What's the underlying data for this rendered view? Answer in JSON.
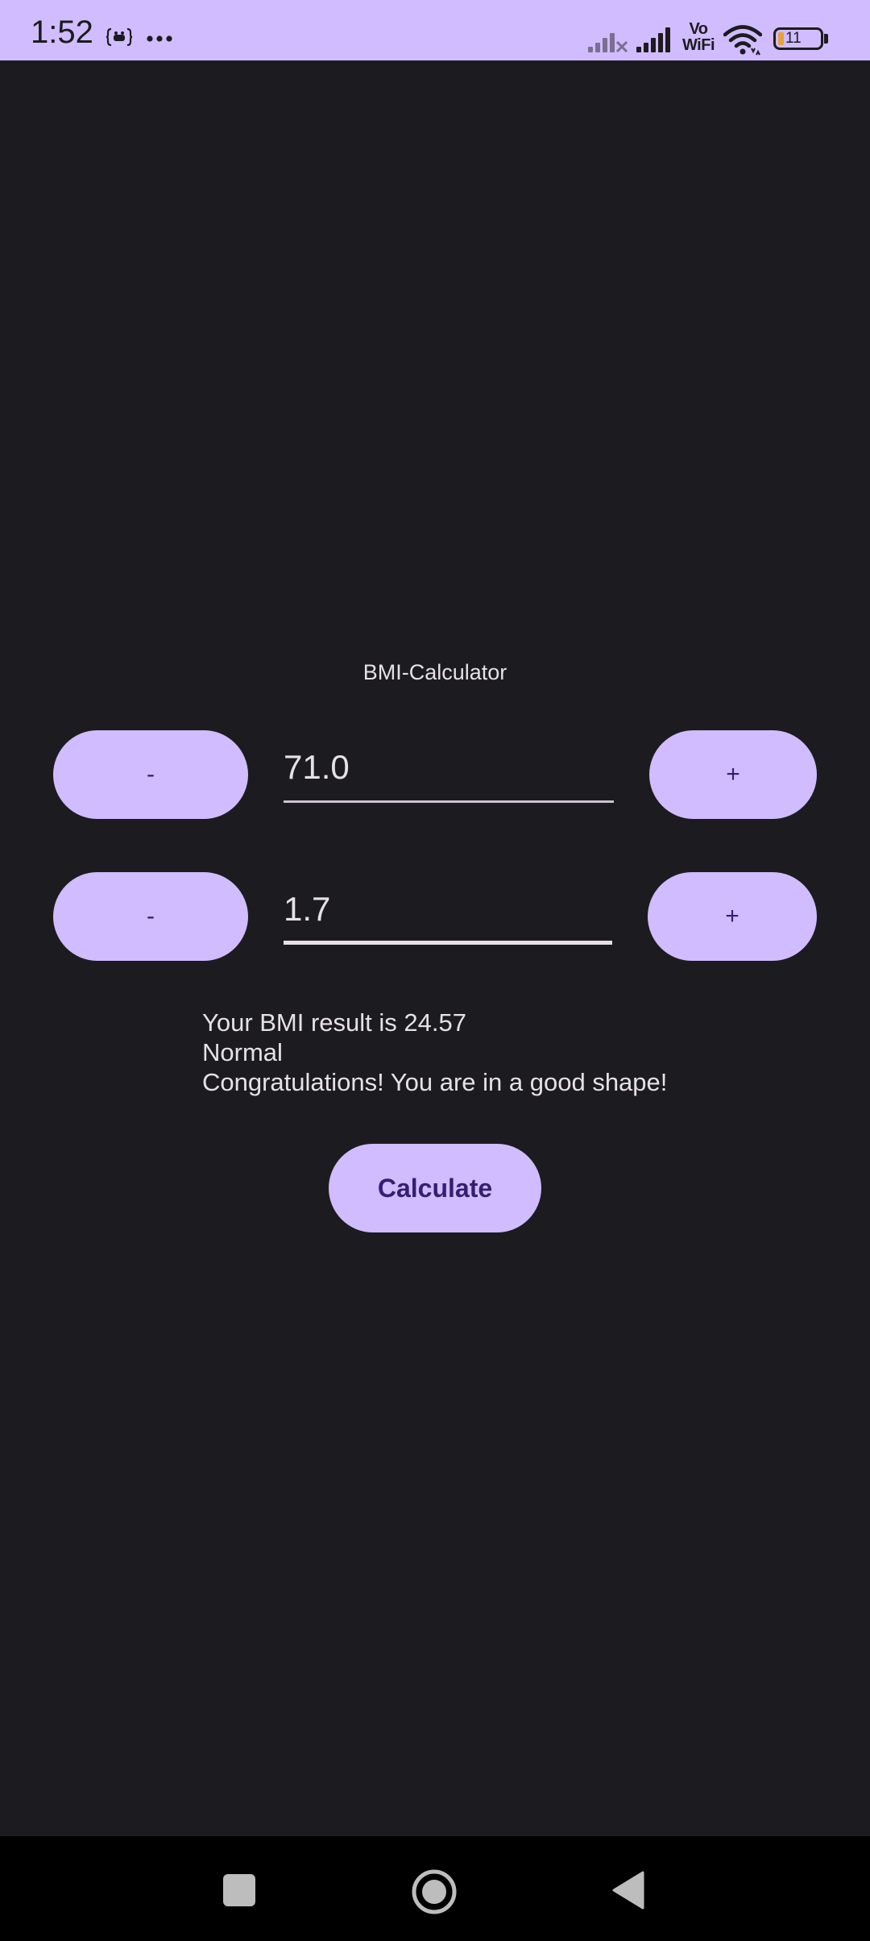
{
  "status_bar": {
    "time": "1:52",
    "battery": "11",
    "signal_label": "Vo WiFi",
    "icons": [
      "data-saver-icon",
      "more-dots-icon",
      "signal-off-icon",
      "signal-icon",
      "vowifi-icon",
      "wifi-icon",
      "battery-icon"
    ]
  },
  "app": {
    "title": "BMI-Calculator",
    "weight": {
      "decrement_label": "-",
      "value": "71.0",
      "increment_label": "+"
    },
    "height": {
      "decrement_label": "-",
      "value": "1.7",
      "increment_label": "+"
    },
    "result": {
      "line1": "Your BMI result is 24.57",
      "line2": "Normal",
      "line3": "Congratulations! You are in a good shape!"
    },
    "calculate_label": "Calculate"
  },
  "nav_bar": {
    "icons": [
      "recents-square-icon",
      "home-circle-icon",
      "back-triangle-icon"
    ]
  },
  "colors": {
    "accent": "#d0bcff",
    "on_accent": "#381e72",
    "background": "#1c1b1f",
    "text": "#e6e1e5"
  }
}
